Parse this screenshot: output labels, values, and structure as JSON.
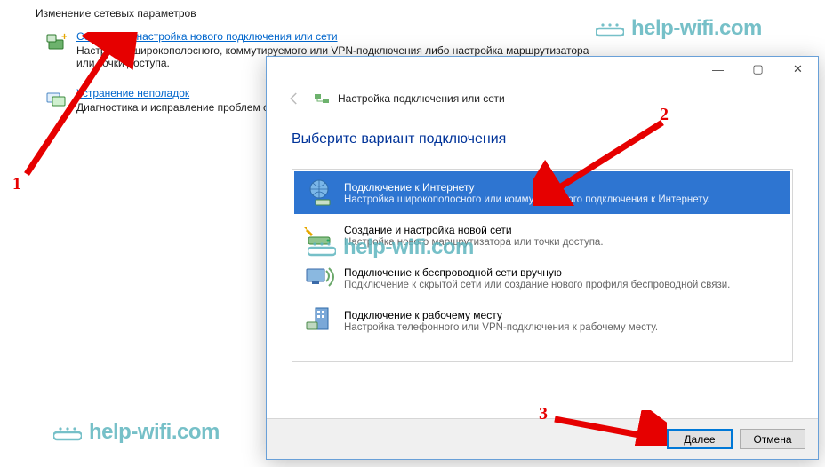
{
  "background": {
    "heading": "Изменение сетевых параметров",
    "item1": {
      "link": "Создание и настройка нового подключения или сети",
      "desc": "Настройка широкополосного, коммутируемого или VPN-подключения либо настройка маршрутизатора или точки доступа."
    },
    "item2": {
      "link": "Устранение неполадок",
      "desc": "Диагностика и исправление проблем с сетью или получение сведений об устранении неполадок."
    }
  },
  "dialog": {
    "header_text": "Настройка подключения или сети",
    "title": "Выберите вариант подключения",
    "options": [
      {
        "title": "Подключение к Интернету",
        "desc": "Настройка широкополосного или коммутируемого подключения к Интернету.",
        "selected": true
      },
      {
        "title": "Создание и настройка новой сети",
        "desc": "Настройка нового маршрутизатора или точки доступа."
      },
      {
        "title": "Подключение к беспроводной сети вручную",
        "desc": "Подключение к скрытой сети или создание нового профиля беспроводной связи."
      },
      {
        "title": "Подключение к рабочему месту",
        "desc": "Настройка телефонного или VPN-подключения к рабочему месту."
      }
    ],
    "buttons": {
      "next": "Далее",
      "cancel": "Отмена"
    }
  },
  "watermark": "help-wifi.com",
  "annotations": {
    "n1": "1",
    "n2": "2",
    "n3": "3"
  }
}
